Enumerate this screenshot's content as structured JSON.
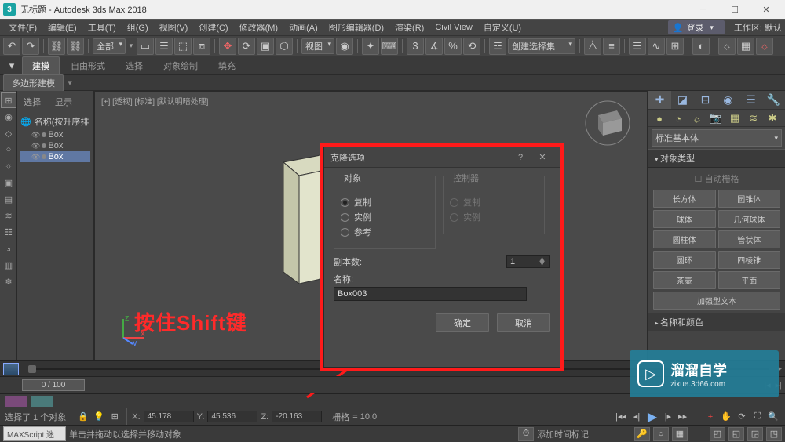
{
  "title_bar": {
    "app_icon": "3",
    "title": "无标题 - Autodesk 3ds Max 2018"
  },
  "menu": {
    "items": [
      "文件(F)",
      "编辑(E)",
      "工具(T)",
      "组(G)",
      "视图(V)",
      "创建(C)",
      "修改器(M)",
      "动画(A)",
      "图形编辑器(D)",
      "渲染(R)",
      "Civil View",
      "自定义(U)"
    ],
    "login_label": "登录",
    "workspace_label": "工作区:",
    "workspace_value": "默认"
  },
  "toolbar": {
    "select_all": "全部",
    "view_label": "视图",
    "create_select": "创建选择集"
  },
  "tabs": {
    "items": [
      "建模",
      "自由形式",
      "选择",
      "对象绘制",
      "填充"
    ]
  },
  "subtab": "多边形建模",
  "scene": {
    "tab_select": "选择",
    "tab_display": "显示",
    "head": "名称(按升序排",
    "items": [
      "Box",
      "Box",
      "Box"
    ],
    "selected_index": 2
  },
  "viewport": {
    "label": "[+] [透视] [标准] [默认明暗处理]",
    "annotation": "按住Shift键"
  },
  "dialog": {
    "title": "克隆选项",
    "group_object": "对象",
    "group_controller": "控制器",
    "opt_copy": "复制",
    "opt_instance": "实例",
    "opt_reference": "参考",
    "copies_label": "副本数:",
    "copies_value": "1",
    "name_label": "名称:",
    "name_value": "Box003",
    "ok": "确定",
    "cancel": "取消"
  },
  "right_panel": {
    "type_select": "标准基本体",
    "rollout_type": "对象类型",
    "auto_grid": "自动栅格",
    "primitives": [
      "长方体",
      "圆锥体",
      "球体",
      "几何球体",
      "圆柱体",
      "管状体",
      "圆环",
      "四棱锥",
      "茶壶",
      "平面",
      "加强型文本"
    ],
    "rollout_name": "名称和颜色"
  },
  "timeline": {
    "scrub": "0  /  100"
  },
  "status1": {
    "selected": "选择了 1 个对象",
    "x": "45.178",
    "y": "45.536",
    "z": "-20.163",
    "grid_label": "栅格",
    "grid_value": "= 10.0"
  },
  "status2": {
    "script": "MAXScript  迷",
    "hint": "单击并拖动以选择并移动对象",
    "add_time_tag": "添加时间标记"
  },
  "watermark": {
    "line1": "溜溜自学",
    "line2": "zixue.3d66.com"
  }
}
